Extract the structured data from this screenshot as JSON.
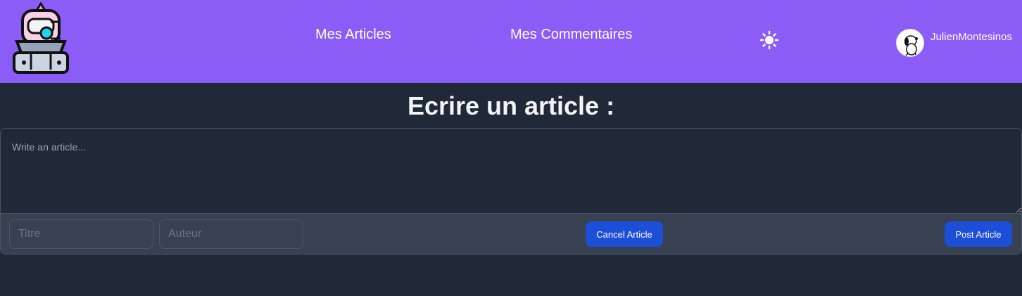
{
  "navbar": {
    "links": [
      "Mes Articles",
      "Mes Commentaires"
    ],
    "username": "JulienMontesinos",
    "logo_icon": "robot-logo-icon",
    "theme_icon": "sun-icon",
    "avatar_icon": "snoopy-avatar-icon",
    "colors": {
      "navbar_bg": "#8b5cf6",
      "page_bg": "#1f2937"
    }
  },
  "main": {
    "title": "Ecrire un article :",
    "form": {
      "article_placeholder": "Write an article...",
      "titre_placeholder": "Titre",
      "auteur_placeholder": "Auteur",
      "cancel_label": "Cancel Article",
      "post_label": "Post Article",
      "button_color": "#1d4ed8"
    }
  }
}
